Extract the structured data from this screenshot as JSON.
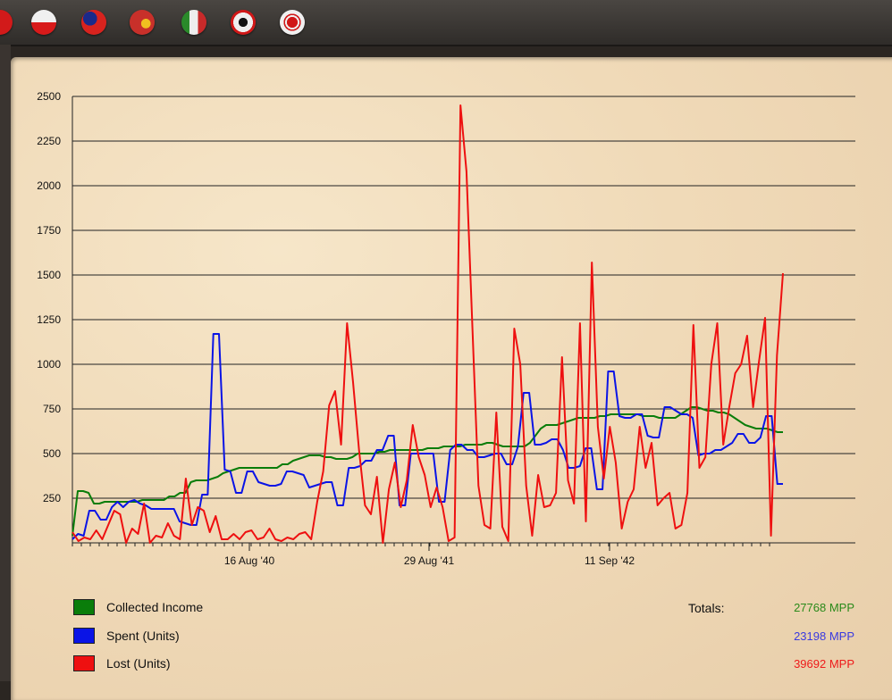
{
  "toolbar": {
    "flags": [
      {
        "name": "poland-flag-icon",
        "color": "#d21a1a"
      },
      {
        "name": "poland-flag-icon",
        "color": "#e8e8e8"
      },
      {
        "name": "china-flag-icon",
        "color": "#d8231e"
      },
      {
        "name": "spain-flag-icon",
        "color": "#c8302a"
      },
      {
        "name": "italy-flag-icon",
        "color": "#3a8a3a"
      },
      {
        "name": "germany-flag-icon",
        "color": "#1f9a2f"
      },
      {
        "name": "japan-flag-icon",
        "color": "#e6e6e6"
      }
    ]
  },
  "chart_data": {
    "type": "line",
    "ylim": [
      0,
      2500
    ],
    "yticks": [
      250,
      500,
      750,
      1000,
      1250,
      1500,
      1750,
      2000,
      2250,
      2500
    ],
    "xticks": [
      "16 Aug '40",
      "29 Aug '41",
      "11 Sep '42"
    ],
    "grid": true,
    "legend_placement": "bottom-left",
    "series": [
      {
        "name": "Collected Income",
        "color": "#0a7d0a",
        "values": [
          40,
          290,
          290,
          280,
          220,
          220,
          230,
          230,
          230,
          230,
          230,
          230,
          230,
          240,
          240,
          240,
          240,
          240,
          260,
          260,
          280,
          280,
          340,
          350,
          350,
          350,
          360,
          370,
          390,
          400,
          410,
          420,
          420,
          420,
          420,
          420,
          420,
          420,
          420,
          440,
          440,
          460,
          470,
          480,
          490,
          490,
          490,
          480,
          480,
          470,
          470,
          470,
          480,
          500,
          500,
          500,
          500,
          510,
          510,
          520,
          520,
          520,
          520,
          520,
          520,
          520,
          530,
          530,
          530,
          540,
          540,
          540,
          540,
          550,
          550,
          550,
          550,
          560,
          560,
          550,
          540,
          540,
          540,
          540,
          540,
          560,
          600,
          640,
          660,
          660,
          660,
          670,
          680,
          690,
          700,
          700,
          700,
          700,
          710,
          710,
          720,
          720,
          720,
          720,
          720,
          720,
          710,
          710,
          710,
          700,
          700,
          700,
          700,
          720,
          740,
          760,
          760,
          750,
          740,
          740,
          730,
          730,
          720,
          700,
          680,
          660,
          650,
          640,
          640,
          640,
          630,
          620,
          620
        ]
      },
      {
        "name": "Spent (Units)",
        "color": "#0a14e6",
        "values": [
          20,
          50,
          40,
          180,
          180,
          130,
          130,
          200,
          230,
          200,
          230,
          240,
          220,
          210,
          190,
          190,
          190,
          190,
          190,
          120,
          110,
          100,
          100,
          270,
          270,
          1170,
          1170,
          410,
          400,
          280,
          280,
          400,
          400,
          340,
          330,
          320,
          320,
          330,
          400,
          400,
          390,
          380,
          310,
          320,
          330,
          340,
          340,
          210,
          210,
          420,
          420,
          430,
          460,
          460,
          520,
          520,
          600,
          600,
          210,
          210,
          500,
          500,
          500,
          500,
          500,
          230,
          230,
          520,
          550,
          550,
          520,
          520,
          480,
          480,
          490,
          500,
          500,
          440,
          440,
          540,
          840,
          840,
          550,
          550,
          560,
          580,
          580,
          520,
          420,
          420,
          430,
          530,
          530,
          300,
          300,
          960,
          960,
          710,
          700,
          700,
          720,
          720,
          600,
          590,
          590,
          760,
          760,
          740,
          720,
          720,
          700,
          490,
          500,
          500,
          520,
          520,
          540,
          560,
          610,
          610,
          560,
          560,
          590,
          710,
          710,
          330,
          330
        ]
      },
      {
        "name": "Lost (Units)",
        "color": "#ee1010",
        "values": [
          60,
          10,
          30,
          20,
          70,
          20,
          100,
          180,
          160,
          0,
          80,
          50,
          220,
          0,
          40,
          30,
          110,
          40,
          20,
          360,
          100,
          200,
          180,
          60,
          150,
          20,
          20,
          50,
          20,
          60,
          70,
          20,
          30,
          80,
          20,
          10,
          30,
          20,
          50,
          60,
          20,
          230,
          400,
          770,
          850,
          550,
          1230,
          900,
          520,
          210,
          160,
          370,
          0,
          300,
          450,
          200,
          350,
          660,
          480,
          380,
          200,
          310,
          200,
          10,
          30,
          2450,
          2080,
          1200,
          320,
          100,
          80,
          730,
          90,
          10,
          1200,
          1000,
          320,
          40,
          380,
          200,
          210,
          280,
          1040,
          350,
          220,
          1230,
          120,
          1570,
          650,
          360,
          650,
          450,
          80,
          230,
          300,
          650,
          420,
          560,
          210,
          250,
          280,
          80,
          100,
          280,
          1220,
          420,
          480,
          1000,
          1230,
          550,
          760,
          950,
          1000,
          1160,
          760,
          1020,
          1260,
          40,
          1050,
          1510
        ]
      }
    ]
  },
  "legend": {
    "items": [
      {
        "label": "Collected Income",
        "color": "#0a7d0a"
      },
      {
        "label": "Spent (Units)",
        "color": "#0a14e6"
      },
      {
        "label": "Lost (Units)",
        "color": "#ee1010"
      }
    ]
  },
  "totals": {
    "label": "Totals:",
    "income": "27768 MPP",
    "income_color": "#2a8a1a",
    "spent": "23198 MPP",
    "spent_color": "#3a3ae0",
    "lost": "39692 MPP",
    "lost_color": "#ee1a1a"
  }
}
